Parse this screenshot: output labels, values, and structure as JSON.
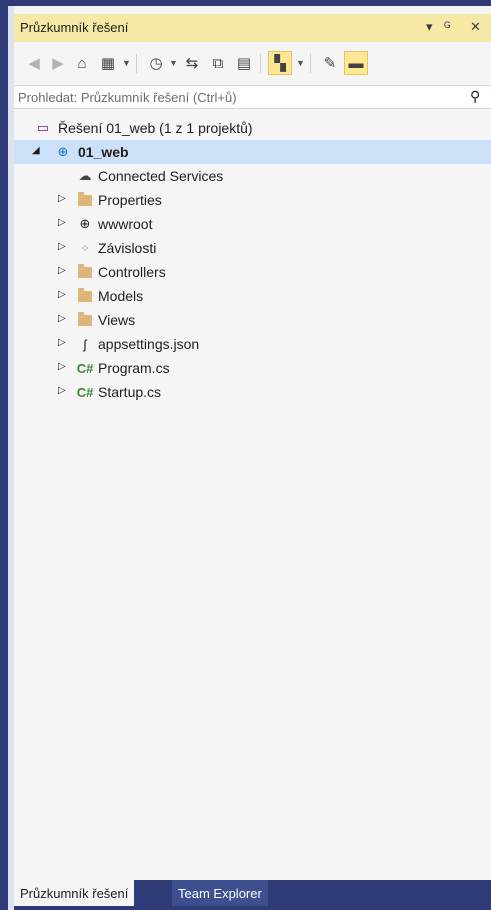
{
  "panel": {
    "title": "Průzkumník řešení",
    "pin_glyph": "▾ ⊥",
    "close_glyph": "✕"
  },
  "search": {
    "placeholder": "Prohledat: Průzkumník řešení (Ctrl+ů)"
  },
  "tree": {
    "solution_label": "Řešení 01_web (1 z 1 projektů)",
    "project_label": "01_web",
    "items": [
      {
        "label": "Connected Services",
        "icon": "cloud-plug-icon"
      },
      {
        "label": "Properties",
        "icon": "wrench-folder-icon"
      },
      {
        "label": "wwwroot",
        "icon": "globe-icon"
      },
      {
        "label": "Závislosti",
        "icon": "dependencies-icon"
      },
      {
        "label": "Controllers",
        "icon": "folder-icon"
      },
      {
        "label": "Models",
        "icon": "folder-icon"
      },
      {
        "label": "Views",
        "icon": "folder-icon"
      },
      {
        "label": "appsettings.json",
        "icon": "json-file-icon"
      },
      {
        "label": "Program.cs",
        "icon": "csharp-file-icon"
      },
      {
        "label": "Startup.cs",
        "icon": "csharp-file-icon"
      }
    ]
  },
  "bottom_tabs": [
    {
      "label": "Průzkumník řešení",
      "active": true
    },
    {
      "label": "Team Explorer",
      "active": false
    }
  ],
  "colors": {
    "frame": "#2e3b76",
    "titlebar": "#f6e9a6",
    "selection": "#cce0f7",
    "folder": "#dcb67a",
    "csharp": "#388a34"
  }
}
